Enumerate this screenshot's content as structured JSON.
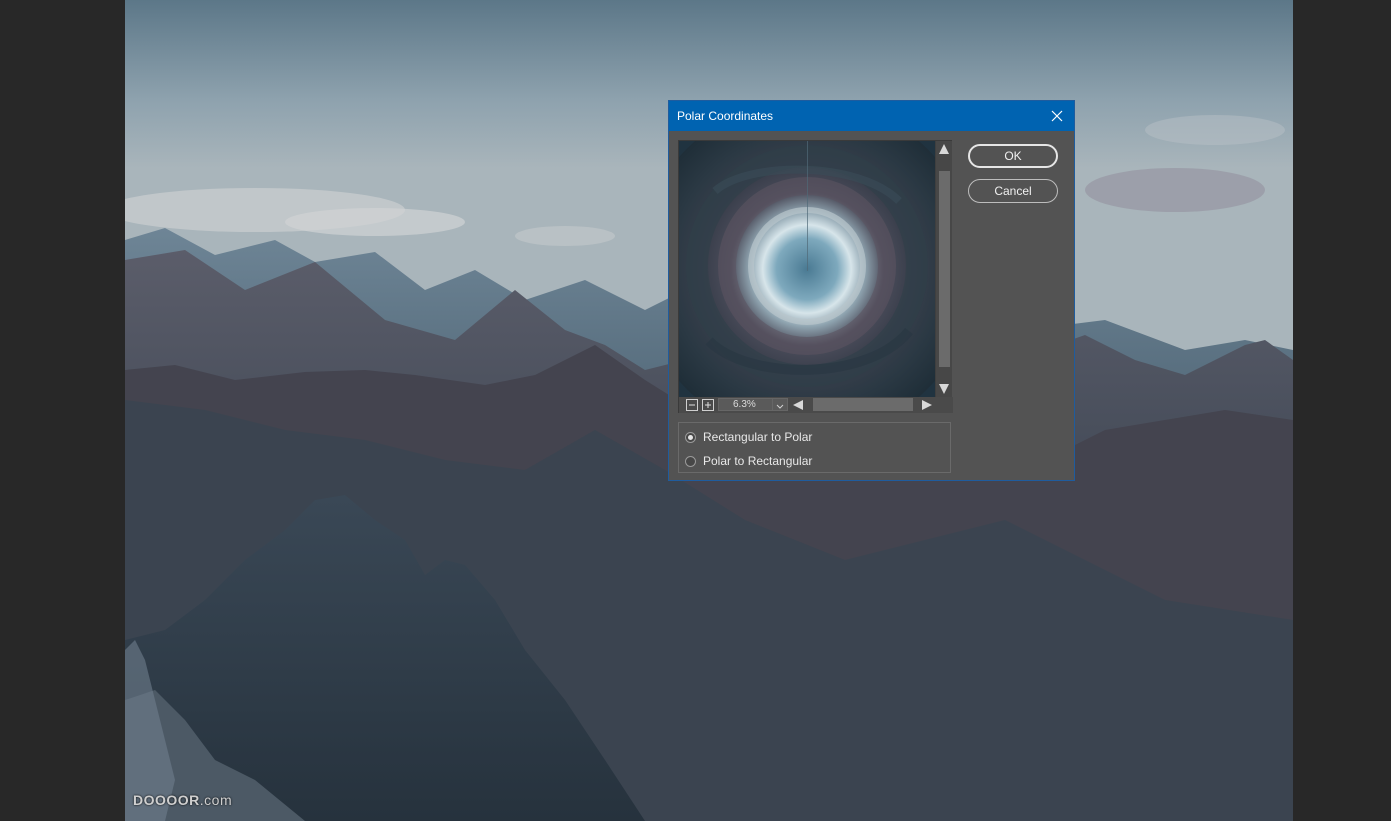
{
  "dialog": {
    "title": "Polar Coordinates",
    "ok_label": "OK",
    "cancel_label": "Cancel",
    "zoom_value": "6.3%",
    "modes": [
      {
        "label": "Rectangular to Polar",
        "selected": true
      },
      {
        "label": "Polar to Rectangular",
        "selected": false
      }
    ]
  },
  "watermark": {
    "text": "DOOOOR",
    "suffix": ".com"
  },
  "colors": {
    "titlebar": "#0063b1",
    "dialog_bg": "#535353",
    "app_bg": "#282828"
  },
  "icons": [
    "close-icon",
    "zoom-out-icon",
    "zoom-in-icon",
    "chevron-down-icon",
    "arrow-up-icon",
    "arrow-down-icon",
    "arrow-left-icon",
    "arrow-right-icon"
  ]
}
